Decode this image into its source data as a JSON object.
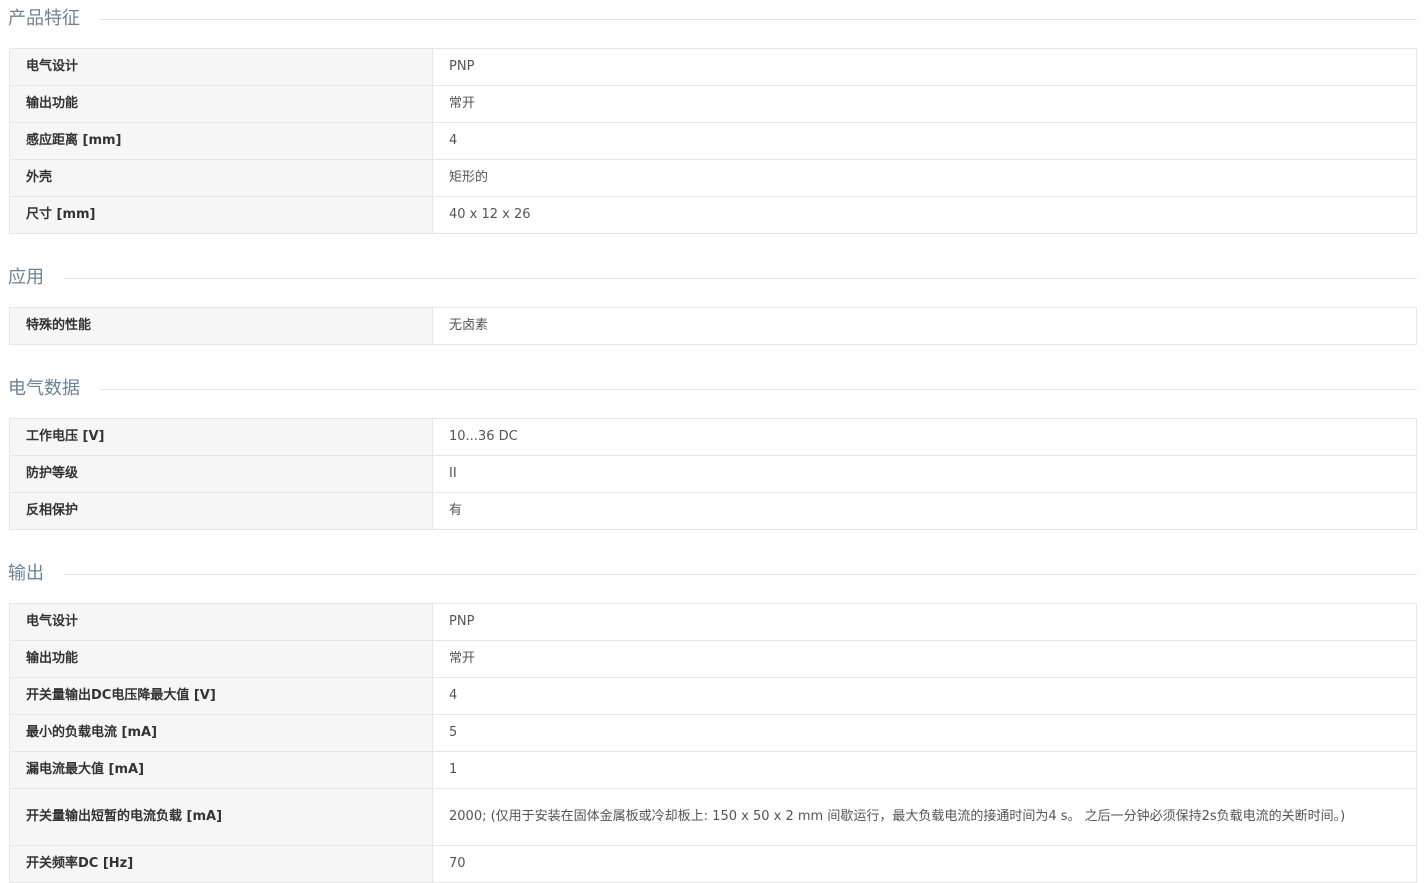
{
  "sections": [
    {
      "title": "产品特征",
      "rows": [
        {
          "label": "电气设计",
          "value": "PNP"
        },
        {
          "label": "输出功能",
          "value": "常开"
        },
        {
          "label": "感应距离 [mm]",
          "value": "4"
        },
        {
          "label": "外壳",
          "value": "矩形的"
        },
        {
          "label": "尺寸 [mm]",
          "value": "40 x 12 x 26"
        }
      ]
    },
    {
      "title": "应用",
      "rows": [
        {
          "label": "特殊的性能",
          "value": "无卤素"
        }
      ]
    },
    {
      "title": "电气数据",
      "rows": [
        {
          "label": "工作电压 [V]",
          "value": "10...36 DC"
        },
        {
          "label": "防护等级",
          "value": "II"
        },
        {
          "label": "反相保护",
          "value": "有"
        }
      ]
    },
    {
      "title": "输出",
      "rows": [
        {
          "label": "电气设计",
          "value": "PNP"
        },
        {
          "label": "输出功能",
          "value": "常开"
        },
        {
          "label": "开关量输出DC电压降最大值 [V]",
          "value": "4"
        },
        {
          "label": "最小的负载电流 [mA]",
          "value": "5"
        },
        {
          "label": "漏电流最大值 [mA]",
          "value": "1"
        },
        {
          "label": "开关量输出短暂的电流负载 [mA]",
          "value": "2000; (仅用于安装在固体金属板或冷却板上: 150 x 50 x 2 mm 间歇运行，最大负载电流的接通时间为4 s。 之后一分钟必须保持2s负载电流的关断时间。)"
        },
        {
          "label": "开关频率DC [Hz]",
          "value": "70"
        }
      ]
    }
  ]
}
